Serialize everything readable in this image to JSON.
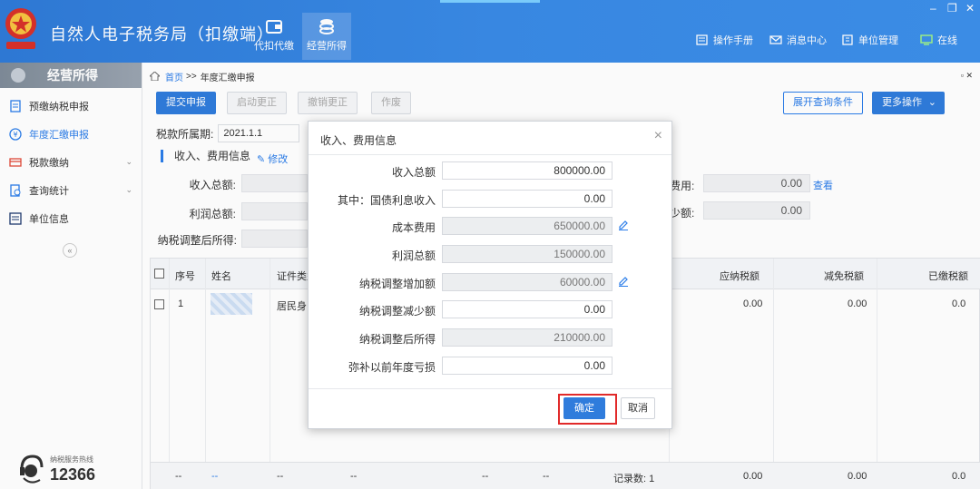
{
  "header": {
    "title": "自然人电子税务局（扣缴端）",
    "nav": [
      {
        "label": "代扣代缴",
        "icon": "wallet-icon"
      },
      {
        "label": "经营所得",
        "icon": "coins-icon"
      }
    ],
    "links": [
      {
        "label": "操作手册",
        "icon": "manual-icon"
      },
      {
        "label": "消息中心",
        "icon": "mail-icon"
      },
      {
        "label": "单位管理",
        "icon": "building-icon"
      },
      {
        "label": "在线",
        "icon": "monitor-icon"
      }
    ],
    "window_controls": {
      "minimize": "–",
      "restore": "❐",
      "close": "✕"
    }
  },
  "sidebar": {
    "title": "经营所得",
    "items": [
      {
        "label": "预缴纳税申报",
        "icon": "clipboard-icon"
      },
      {
        "label": "年度汇缴申报",
        "icon": "yen-icon"
      },
      {
        "label": "税款缴纳",
        "icon": "payment-icon"
      },
      {
        "label": "查询统计",
        "icon": "query-icon"
      },
      {
        "label": "单位信息",
        "icon": "list-icon"
      }
    ],
    "collapse": "«",
    "hotline_label": "纳税服务热线",
    "hotline_number": "12366"
  },
  "breadcrumb": {
    "home": "首页",
    "sep": ">>",
    "current": "年度汇缴申报"
  },
  "toolbar": {
    "submit": "提交申报",
    "start_correct": "启动更正",
    "cancel_correct": "撤销更正",
    "void": "作废",
    "expand_query": "展开查询条件",
    "more_ops": "更多操作"
  },
  "tax_period": {
    "label": "税款所属期:",
    "value": "2021.1.1"
  },
  "section": {
    "title": "收入、费用信息",
    "edit": "修改"
  },
  "summary": {
    "income_label": "收入总额:",
    "profit_label": "利润总额:",
    "adjusted_label": "纳税调整后所得:",
    "cost_label_tail": "费用:",
    "cost_value": "0.00",
    "view": "查看",
    "reduce_label_tail": "少额:",
    "reduce_value": "0.00"
  },
  "grid": {
    "headers": [
      "序号",
      "姓名",
      "证件类型",
      "应纳税额",
      "减免税额",
      "已缴税额"
    ],
    "row": {
      "index": "1",
      "id_type": "居民身",
      "tax_due": "0.00",
      "tax_exempt": "0.00",
      "tax_paid": "0.0"
    },
    "footer": {
      "dash": "--",
      "record_count": "记录数: 1",
      "v1": "0.00",
      "v2": "0.00",
      "v3": "0.0"
    }
  },
  "dialog": {
    "title": "收入、费用信息",
    "close": "×",
    "fields": [
      {
        "label": "收入总额",
        "value": "800000.00",
        "readonly": false
      },
      {
        "label": "其中：国债利息收入",
        "value": "0.00",
        "readonly": false
      },
      {
        "label": "成本费用",
        "value": "650000.00",
        "readonly": true
      },
      {
        "label": "利润总额",
        "value": "150000.00",
        "readonly": true
      },
      {
        "label": "纳税调整增加额",
        "value": "60000.00",
        "readonly": true
      },
      {
        "label": "纳税调整减少额",
        "value": "0.00",
        "readonly": false
      },
      {
        "label": "纳税调整后所得",
        "value": "210000.00",
        "readonly": true
      },
      {
        "label": "弥补以前年度亏损",
        "value": "0.00",
        "readonly": false
      }
    ],
    "ok": "确定",
    "cancel": "取消"
  },
  "colors": {
    "accent": "#2f7cdc",
    "header": "#3a8ae6",
    "highlight": "#e12a2a"
  }
}
